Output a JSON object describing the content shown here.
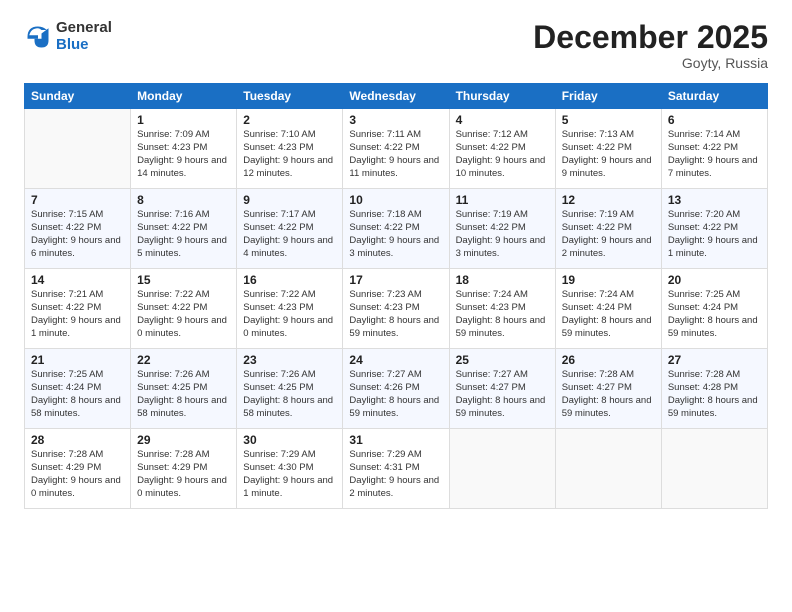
{
  "logo": {
    "general": "General",
    "blue": "Blue"
  },
  "header": {
    "month": "December 2025",
    "location": "Goyty, Russia"
  },
  "weekdays": [
    "Sunday",
    "Monday",
    "Tuesday",
    "Wednesday",
    "Thursday",
    "Friday",
    "Saturday"
  ],
  "weeks": [
    [
      {
        "day": null
      },
      {
        "day": 1,
        "sunrise": "7:09 AM",
        "sunset": "4:23 PM",
        "daylight": "9 hours and 14 minutes."
      },
      {
        "day": 2,
        "sunrise": "7:10 AM",
        "sunset": "4:23 PM",
        "daylight": "9 hours and 12 minutes."
      },
      {
        "day": 3,
        "sunrise": "7:11 AM",
        "sunset": "4:22 PM",
        "daylight": "9 hours and 11 minutes."
      },
      {
        "day": 4,
        "sunrise": "7:12 AM",
        "sunset": "4:22 PM",
        "daylight": "9 hours and 10 minutes."
      },
      {
        "day": 5,
        "sunrise": "7:13 AM",
        "sunset": "4:22 PM",
        "daylight": "9 hours and 9 minutes."
      },
      {
        "day": 6,
        "sunrise": "7:14 AM",
        "sunset": "4:22 PM",
        "daylight": "9 hours and 7 minutes."
      }
    ],
    [
      {
        "day": 7,
        "sunrise": "7:15 AM",
        "sunset": "4:22 PM",
        "daylight": "9 hours and 6 minutes."
      },
      {
        "day": 8,
        "sunrise": "7:16 AM",
        "sunset": "4:22 PM",
        "daylight": "9 hours and 5 minutes."
      },
      {
        "day": 9,
        "sunrise": "7:17 AM",
        "sunset": "4:22 PM",
        "daylight": "9 hours and 4 minutes."
      },
      {
        "day": 10,
        "sunrise": "7:18 AM",
        "sunset": "4:22 PM",
        "daylight": "9 hours and 3 minutes."
      },
      {
        "day": 11,
        "sunrise": "7:19 AM",
        "sunset": "4:22 PM",
        "daylight": "9 hours and 3 minutes."
      },
      {
        "day": 12,
        "sunrise": "7:19 AM",
        "sunset": "4:22 PM",
        "daylight": "9 hours and 2 minutes."
      },
      {
        "day": 13,
        "sunrise": "7:20 AM",
        "sunset": "4:22 PM",
        "daylight": "9 hours and 1 minute."
      }
    ],
    [
      {
        "day": 14,
        "sunrise": "7:21 AM",
        "sunset": "4:22 PM",
        "daylight": "9 hours and 1 minute."
      },
      {
        "day": 15,
        "sunrise": "7:22 AM",
        "sunset": "4:22 PM",
        "daylight": "9 hours and 0 minutes."
      },
      {
        "day": 16,
        "sunrise": "7:22 AM",
        "sunset": "4:23 PM",
        "daylight": "9 hours and 0 minutes."
      },
      {
        "day": 17,
        "sunrise": "7:23 AM",
        "sunset": "4:23 PM",
        "daylight": "8 hours and 59 minutes."
      },
      {
        "day": 18,
        "sunrise": "7:24 AM",
        "sunset": "4:23 PM",
        "daylight": "8 hours and 59 minutes."
      },
      {
        "day": 19,
        "sunrise": "7:24 AM",
        "sunset": "4:24 PM",
        "daylight": "8 hours and 59 minutes."
      },
      {
        "day": 20,
        "sunrise": "7:25 AM",
        "sunset": "4:24 PM",
        "daylight": "8 hours and 59 minutes."
      }
    ],
    [
      {
        "day": 21,
        "sunrise": "7:25 AM",
        "sunset": "4:24 PM",
        "daylight": "8 hours and 58 minutes."
      },
      {
        "day": 22,
        "sunrise": "7:26 AM",
        "sunset": "4:25 PM",
        "daylight": "8 hours and 58 minutes."
      },
      {
        "day": 23,
        "sunrise": "7:26 AM",
        "sunset": "4:25 PM",
        "daylight": "8 hours and 58 minutes."
      },
      {
        "day": 24,
        "sunrise": "7:27 AM",
        "sunset": "4:26 PM",
        "daylight": "8 hours and 59 minutes."
      },
      {
        "day": 25,
        "sunrise": "7:27 AM",
        "sunset": "4:27 PM",
        "daylight": "8 hours and 59 minutes."
      },
      {
        "day": 26,
        "sunrise": "7:28 AM",
        "sunset": "4:27 PM",
        "daylight": "8 hours and 59 minutes."
      },
      {
        "day": 27,
        "sunrise": "7:28 AM",
        "sunset": "4:28 PM",
        "daylight": "8 hours and 59 minutes."
      }
    ],
    [
      {
        "day": 28,
        "sunrise": "7:28 AM",
        "sunset": "4:29 PM",
        "daylight": "9 hours and 0 minutes."
      },
      {
        "day": 29,
        "sunrise": "7:28 AM",
        "sunset": "4:29 PM",
        "daylight": "9 hours and 0 minutes."
      },
      {
        "day": 30,
        "sunrise": "7:29 AM",
        "sunset": "4:30 PM",
        "daylight": "9 hours and 1 minute."
      },
      {
        "day": 31,
        "sunrise": "7:29 AM",
        "sunset": "4:31 PM",
        "daylight": "9 hours and 2 minutes."
      },
      {
        "day": null
      },
      {
        "day": null
      },
      {
        "day": null
      }
    ]
  ]
}
